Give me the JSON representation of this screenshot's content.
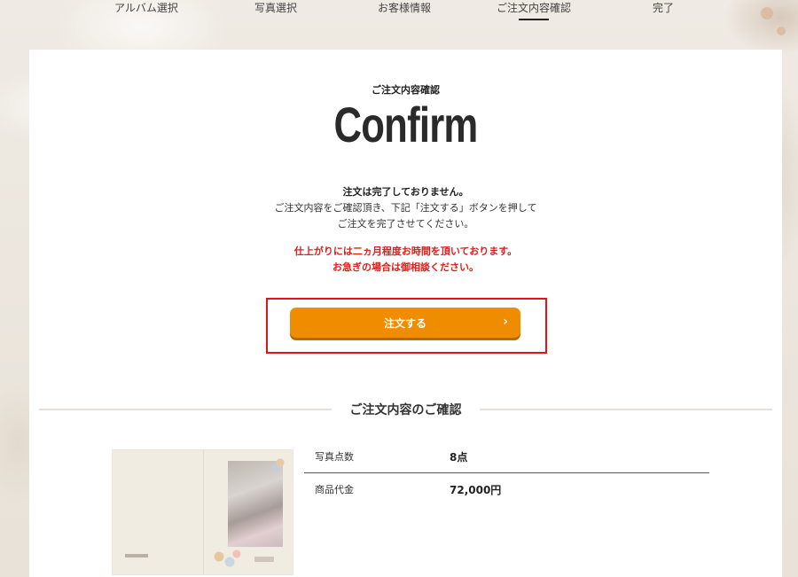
{
  "steps": [
    {
      "label": "アルバム選択"
    },
    {
      "label": "写真選択"
    },
    {
      "label": "お客様情報"
    },
    {
      "label": "ご注文内容確認",
      "active": true
    },
    {
      "label": "完了"
    }
  ],
  "header": {
    "subtitle": "ご注文内容確認",
    "title": "Confirm"
  },
  "message": {
    "bold": "注文は完了しておりません。",
    "line1": "ご注文内容をご確認頂き、下記「注文する」ボタンを押して",
    "line2": "ご注文を完了させてください。"
  },
  "warning": {
    "line1": "仕上がりには二ヵ月程度お時間を頂いております。",
    "line2": "お急ぎの場合は御相談ください。"
  },
  "order_button": {
    "label": "注文する",
    "icon": "chevron-right-icon"
  },
  "summary": {
    "heading": "ご注文内容のご確認",
    "rows": [
      {
        "key": "写真点数",
        "value": "8点"
      },
      {
        "key": "商品代金",
        "value": "72,000円"
      }
    ]
  },
  "colors": {
    "accent": "#ef8c00",
    "highlight": "#e8101a",
    "warning": "#d9201d"
  }
}
